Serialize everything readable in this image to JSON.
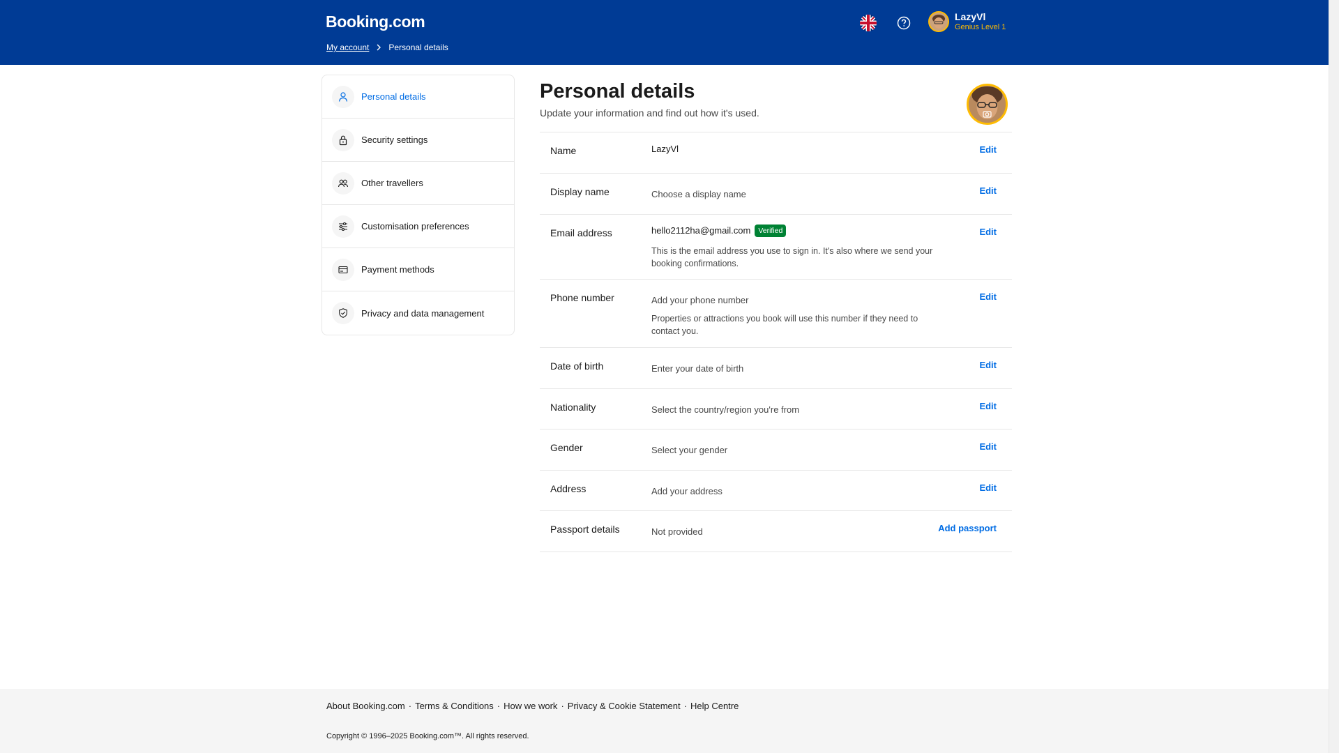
{
  "header": {
    "logo": "Booking.com",
    "breadcrumb": {
      "parent": "My account",
      "current": "Personal details"
    },
    "user": {
      "name": "LazyVl",
      "level": "Genius Level 1"
    },
    "icons": {
      "language": "uk-flag-icon",
      "help": "help-circle-icon"
    }
  },
  "sidebar": {
    "items": [
      {
        "label": "Personal details",
        "icon": "person-icon",
        "active": true
      },
      {
        "label": "Security settings",
        "icon": "lock-icon"
      },
      {
        "label": "Other travellers",
        "icon": "people-icon"
      },
      {
        "label": "Customisation preferences",
        "icon": "sliders-icon"
      },
      {
        "label": "Payment methods",
        "icon": "card-icon"
      },
      {
        "label": "Privacy and data management",
        "icon": "shield-check-icon"
      }
    ]
  },
  "main": {
    "title": "Personal details",
    "subtitle": "Update your information and find out how it's used.",
    "rows": [
      {
        "label": "Name",
        "value": "LazyVl",
        "action": "Edit"
      },
      {
        "label": "Display name",
        "value": "Choose a display name",
        "action": "Edit"
      },
      {
        "label": "Email address",
        "value": "hello2112ha@gmail.com",
        "badge": "Verified",
        "description": "This is the email address you use to sign in. It's also where we send your booking confirmations.",
        "action": "Edit"
      },
      {
        "label": "Phone number",
        "value": "Add your phone number",
        "description": "Properties or attractions you book will use this number if they need to contact you.",
        "action": "Edit"
      },
      {
        "label": "Date of birth",
        "value": "Enter your date of birth",
        "action": "Edit"
      },
      {
        "label": "Nationality",
        "value": "Select the country/region you're from",
        "action": "Edit"
      },
      {
        "label": "Gender",
        "value": "Select your gender",
        "action": "Edit"
      },
      {
        "label": "Address",
        "value": "Add your address",
        "action": "Edit"
      },
      {
        "label": "Passport details",
        "value": "Not provided",
        "action": "Add passport"
      }
    ]
  },
  "footer": {
    "links": [
      "About Booking.com",
      "Terms & Conditions",
      "How we work",
      "Privacy & Cookie Statement",
      "Help Centre"
    ],
    "separator": "·",
    "copyright": "Copyright © 1996–2025 Booking.com™. All rights reserved."
  },
  "colors": {
    "brand": "#003b95",
    "link": "#006ce4",
    "genius": "#febb02",
    "verified": "#008234"
  }
}
